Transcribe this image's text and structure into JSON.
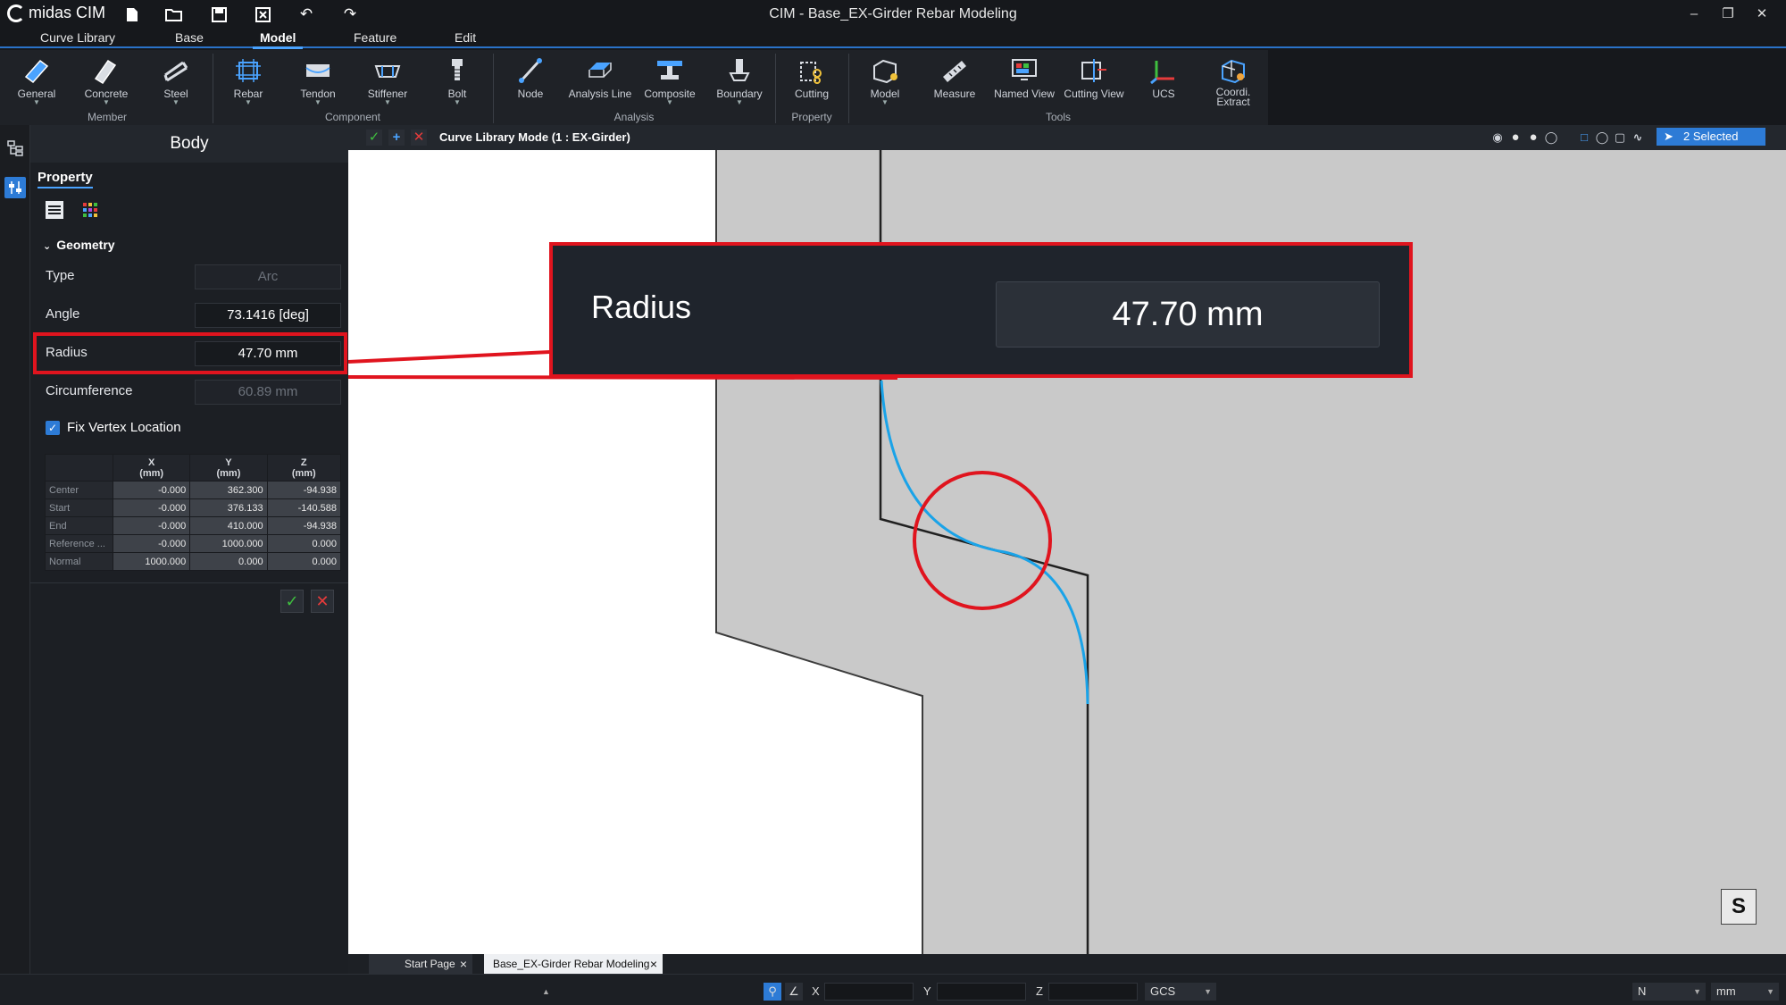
{
  "app": {
    "logo_text": "midas CIM",
    "window_title": "CIM - Base_EX-Girder Rebar Modeling"
  },
  "menu": {
    "tabs": [
      "Curve Library",
      "Base",
      "Model",
      "Feature",
      "Edit"
    ],
    "active": "Model"
  },
  "ribbon": {
    "buttons": [
      "General",
      "Concrete",
      "Steel",
      "Rebar",
      "Tendon",
      "Stiffener",
      "Bolt",
      "Node",
      "Analysis Line",
      "Composite",
      "Boundary",
      "Cutting",
      "Model",
      "Measure",
      "Named View",
      "Cutting View",
      "UCS",
      "Coordi. Extract"
    ],
    "groups": [
      "Member",
      "Component",
      "Analysis",
      "Property",
      "Tools"
    ]
  },
  "panel": {
    "title": "Body",
    "tab": "Property",
    "section": "Geometry",
    "fields": [
      {
        "label": "Type",
        "value": "Arc",
        "enabled": false
      },
      {
        "label": "Angle",
        "value": "73.1416 [deg]",
        "enabled": true
      },
      {
        "label": "Radius",
        "value": "47.70 mm",
        "enabled": true
      },
      {
        "label": "Circumference",
        "value": "60.89 mm",
        "enabled": false
      }
    ],
    "checkbox_label": "Fix Vertex Location",
    "checkbox_checked": true,
    "table": {
      "headers": [
        [
          "X",
          "(mm)"
        ],
        [
          "Y",
          "(mm)"
        ],
        [
          "Z",
          "(mm)"
        ]
      ],
      "rows": [
        {
          "name": "Center",
          "values": [
            "-0.000",
            "362.300",
            "-94.938"
          ]
        },
        {
          "name": "Start",
          "values": [
            "-0.000",
            "376.133",
            "-140.588"
          ]
        },
        {
          "name": "End",
          "values": [
            "-0.000",
            "410.000",
            "-94.938"
          ]
        },
        {
          "name": "Reference ...",
          "values": [
            "-0.000",
            "1000.000",
            "0.000"
          ]
        },
        {
          "name": "Normal",
          "values": [
            "1000.000",
            "0.000",
            "0.000"
          ]
        }
      ]
    }
  },
  "viewport": {
    "mode_text": "Curve Library Mode (1 : EX-Girder)",
    "selected_text": "2 Selected",
    "snap_label": "S"
  },
  "zoom_callout": {
    "label": "Radius",
    "value": "47.70 mm"
  },
  "doc_tabs": [
    "Start Page",
    "Base_EX-Girder Rebar Modeling"
  ],
  "status": {
    "x_label": "X",
    "y_label": "Y",
    "z_label": "Z",
    "coord_system": "GCS",
    "force_unit": "N",
    "length_unit": "mm"
  },
  "colors": {
    "accent": "#2d7bd6",
    "highlight": "#e0141e",
    "curve": "#1aa3e8",
    "ok": "#3fbf3f",
    "cancel": "#e53b3b"
  }
}
